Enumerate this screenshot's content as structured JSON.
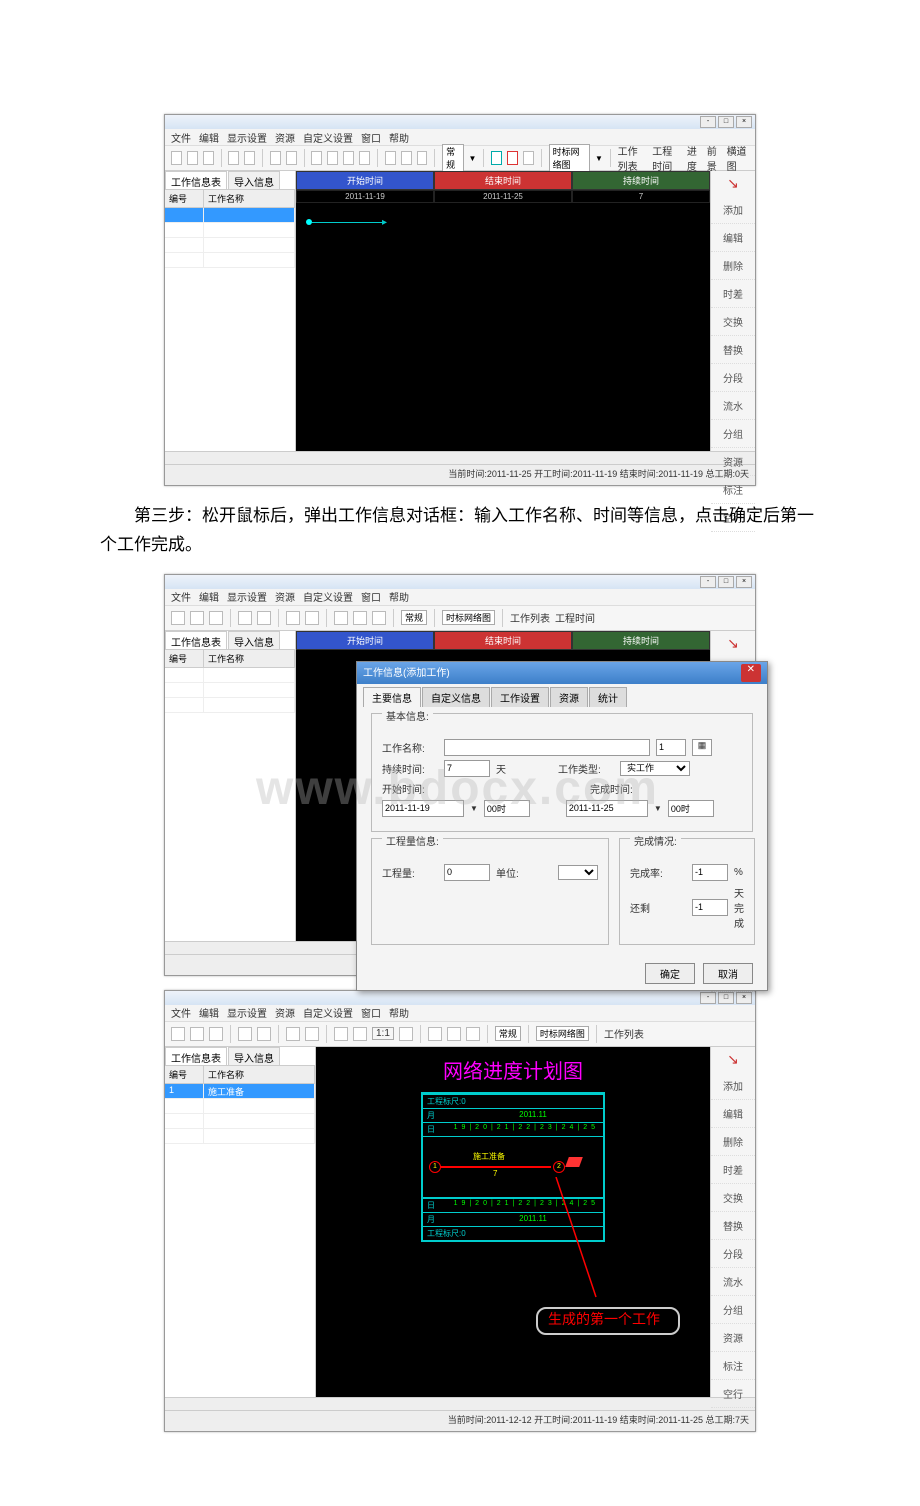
{
  "menus": [
    "文件",
    "编辑",
    "显示设置",
    "资源",
    "自定义设置",
    "窗口",
    "帮助"
  ],
  "toolbar_labels": {
    "normal": "常规",
    "view_label": "时标网络图",
    "list": "工作列表",
    "project_time": "工程时间",
    "progress": "进度",
    "front": "前景",
    "cross": "横道图"
  },
  "side_tabs": {
    "tab1": "工作信息表",
    "tab2": "导入信息"
  },
  "grid": {
    "col1": "编号",
    "col2": "工作名称",
    "row1_id": "1",
    "row1_name": "施工准备"
  },
  "time_header": {
    "start": "开始时间",
    "end": "结束时间",
    "dur": "持续时间",
    "d1": "2011-11-19",
    "d2": "2011-11-25",
    "d3": "7"
  },
  "right_panel": [
    "添加",
    "编辑",
    "删除",
    "时差",
    "交换",
    "替换",
    "分段",
    "流水",
    "分组",
    "资源",
    "标注",
    "空行"
  ],
  "status": {
    "s1": "当前时间:2011-11-25  开工时间:2011-11-19  结束时间:2011-11-19  总工期:0天",
    "s2": "当前时间:2011-11-25  开工时间:2011-11-19  结束时间:2011-11-19  总工期:0天",
    "s3": "当前时间:2011-12-12  开工时间:2011-11-19  结束时间:2011-11-25  总工期:7天"
  },
  "step_text": "第三步：松开鼠标后，弹出工作信息对话框：输入工作名称、时间等信息，点击确定后第一个工作完成。",
  "dialog": {
    "title": "工作信息(添加工作)",
    "tabs": [
      "主要信息",
      "自定义信息",
      "工作设置",
      "资源",
      "统计"
    ],
    "group1": "基本信息:",
    "name_label": "工作名称:",
    "id_val": "1",
    "dur_label": "持续时间:",
    "dur_val": "7",
    "dur_unit": "天",
    "type_label": "工作类型:",
    "type_val": "实工作",
    "start_label": "开始时间:",
    "start_val": "2011-11-19",
    "start_hour": "00时",
    "end_label": "完成时间:",
    "end_val": "2011-11-25",
    "end_hour": "00时",
    "group2": "工程量信息:",
    "qty_label": "工程量:",
    "qty_val": "0",
    "unit_label": "单位:",
    "prog_group": "完成情况:",
    "pct_label": "完成率:",
    "pct_val": "-1",
    "pct_unit": "%",
    "remain_label": "还剩",
    "remain_val": "-1",
    "remain_unit": "天完成",
    "ok": "确定",
    "cancel": "取消"
  },
  "chart": {
    "title": "网络进度计划图",
    "scale": "工程标尺:0",
    "month": "月",
    "month_val": "2011.11",
    "day": "日",
    "day_vals": "19|20|21|22|23|24|25",
    "task": "施工准备",
    "task_dur": "7",
    "annotation": "生成的第一个工作"
  },
  "watermark": "www.bdocx.com"
}
